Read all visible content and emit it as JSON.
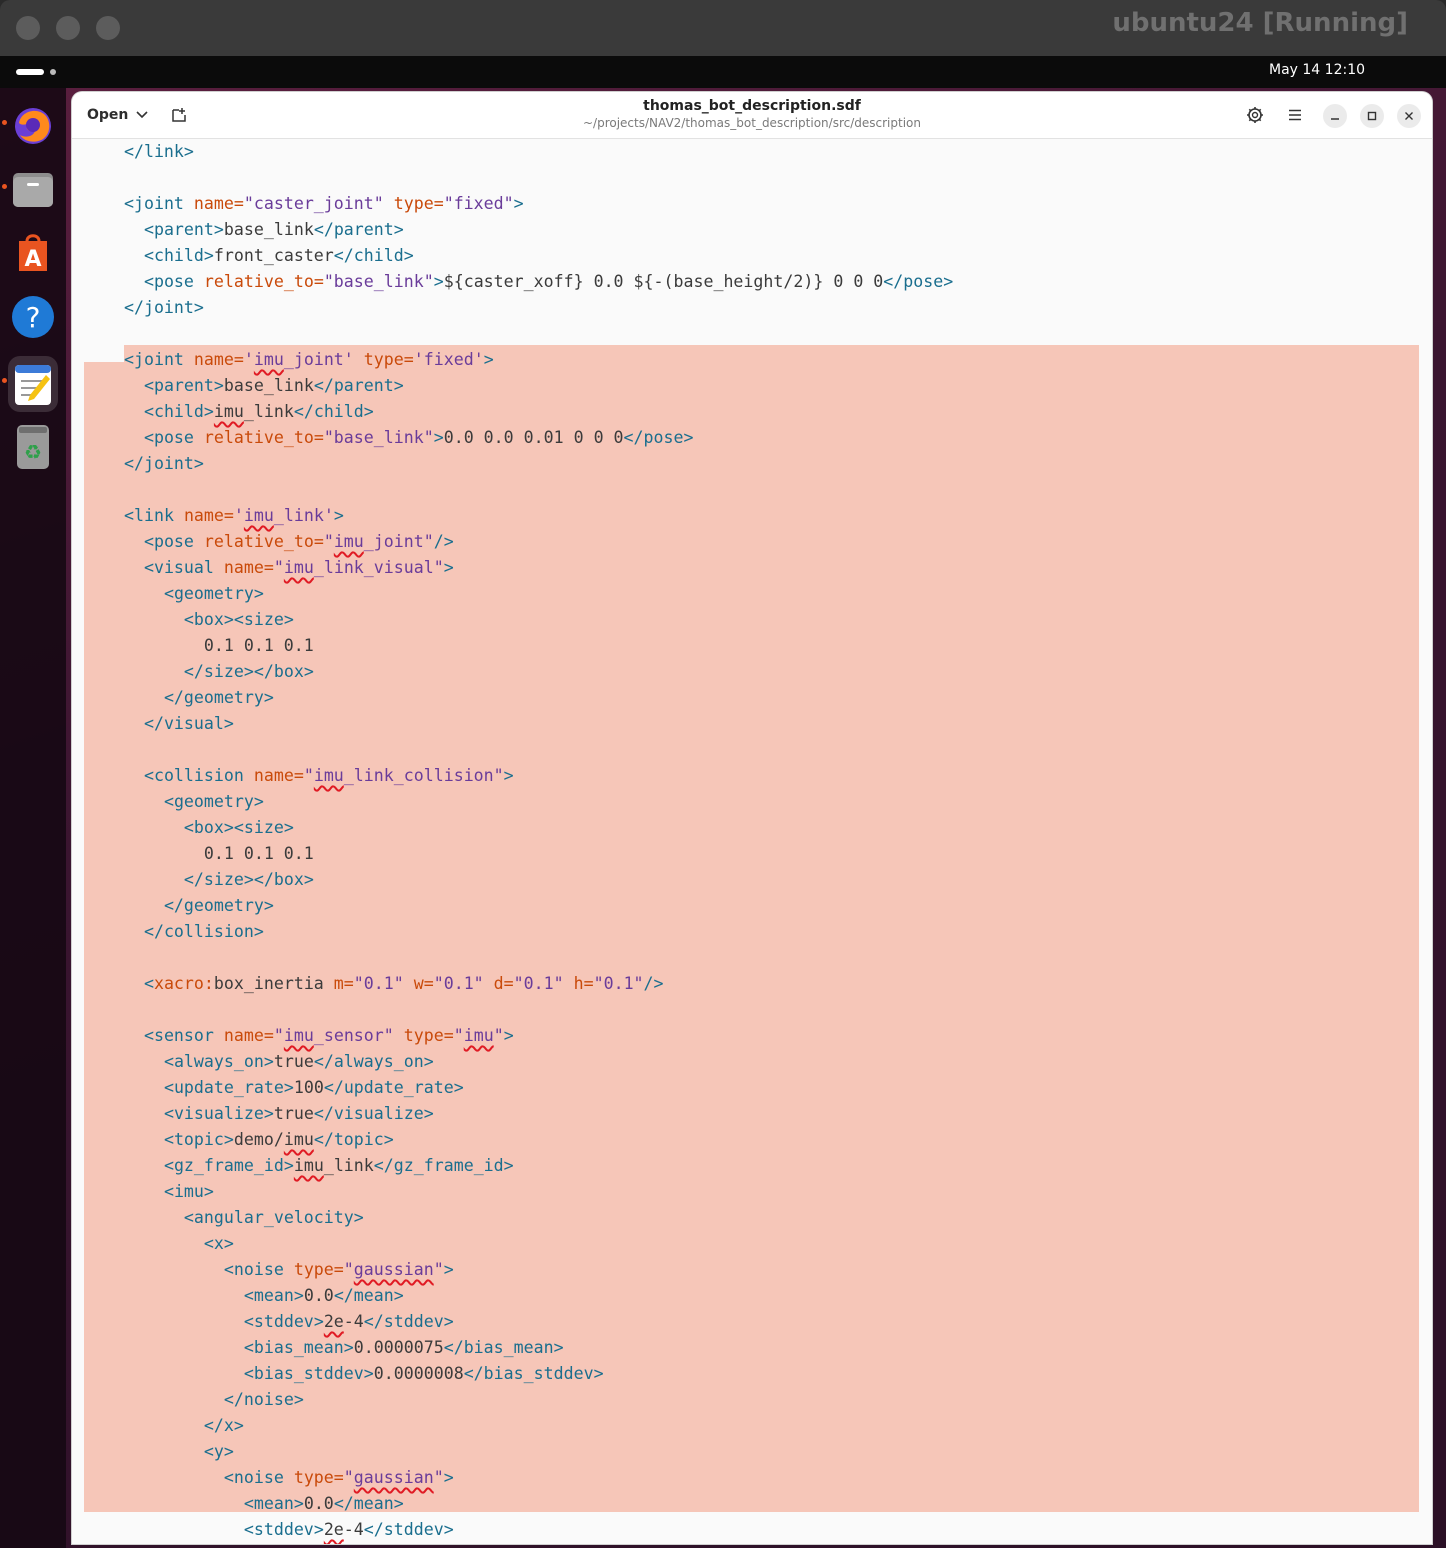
{
  "host": {
    "title": "ubuntu24 [Running]"
  },
  "topbar": {
    "clock": "May 14  12:10"
  },
  "dock": {
    "items": [
      "firefox-icon",
      "files-icon",
      "app-center-icon",
      "help-icon",
      "text-editor-icon",
      "trash-icon"
    ]
  },
  "editor": {
    "open_label": "Open",
    "title": "thomas_bot_description.sdf",
    "subtitle": "~/projects/NAV2/thomas_bot_description/src/description"
  },
  "colors": {
    "selection": "#f6c6b8",
    "tag": "#1a6e8e",
    "attribute": "#c94a0a",
    "string": "#6a3c9a",
    "spell_error": "#e01b24"
  },
  "code": {
    "lines": [
      "    </link>",
      "",
      "    <joint name=\"caster_joint\" type=\"fixed\">",
      "      <parent>base_link</parent>",
      "      <child>front_caster</child>",
      "      <pose relative_to=\"base_link\">${caster_xoff} 0.0 ${-(base_height/2)} 0 0 0</pose>",
      "    </joint>",
      "",
      "    <joint name='imu_joint' type='fixed'>",
      "      <parent>base_link</parent>",
      "      <child>imu_link</child>",
      "      <pose relative_to=\"base_link\">0.0 0.0 0.01 0 0 0</pose>",
      "    </joint>",
      "",
      "    <link name='imu_link'>",
      "      <pose relative_to=\"imu_joint\"/>",
      "      <visual name=\"imu_link_visual\">",
      "        <geometry>",
      "          <box><size>",
      "            0.1 0.1 0.1",
      "          </size></box>",
      "        </geometry>",
      "      </visual>",
      "",
      "      <collision name=\"imu_link_collision\">",
      "        <geometry>",
      "          <box><size>",
      "            0.1 0.1 0.1",
      "          </size></box>",
      "        </geometry>",
      "      </collision>",
      "",
      "      <xacro:box_inertia m=\"0.1\" w=\"0.1\" d=\"0.1\" h=\"0.1\"/>",
      "",
      "      <sensor name=\"imu_sensor\" type=\"imu\">",
      "        <always_on>true</always_on>",
      "        <update_rate>100</update_rate>",
      "        <visualize>true</visualize>",
      "        <topic>demo/imu</topic>",
      "        <gz_frame_id>imu_link</gz_frame_id>",
      "        <imu>",
      "          <angular_velocity>",
      "            <x>",
      "              <noise type=\"gaussian\">",
      "                <mean>0.0</mean>",
      "                <stddev>2e-4</stddev>",
      "                <bias_mean>0.0000075</bias_mean>",
      "                <bias_stddev>0.0000008</bias_stddev>",
      "              </noise>",
      "            </x>",
      "            <y>",
      "              <noise type=\"gaussian\">",
      "                <mean>0.0</mean>",
      "                <stddev>2e-4</stddev>"
    ],
    "selection_start_line": 8,
    "selection_end_line": 53
  }
}
